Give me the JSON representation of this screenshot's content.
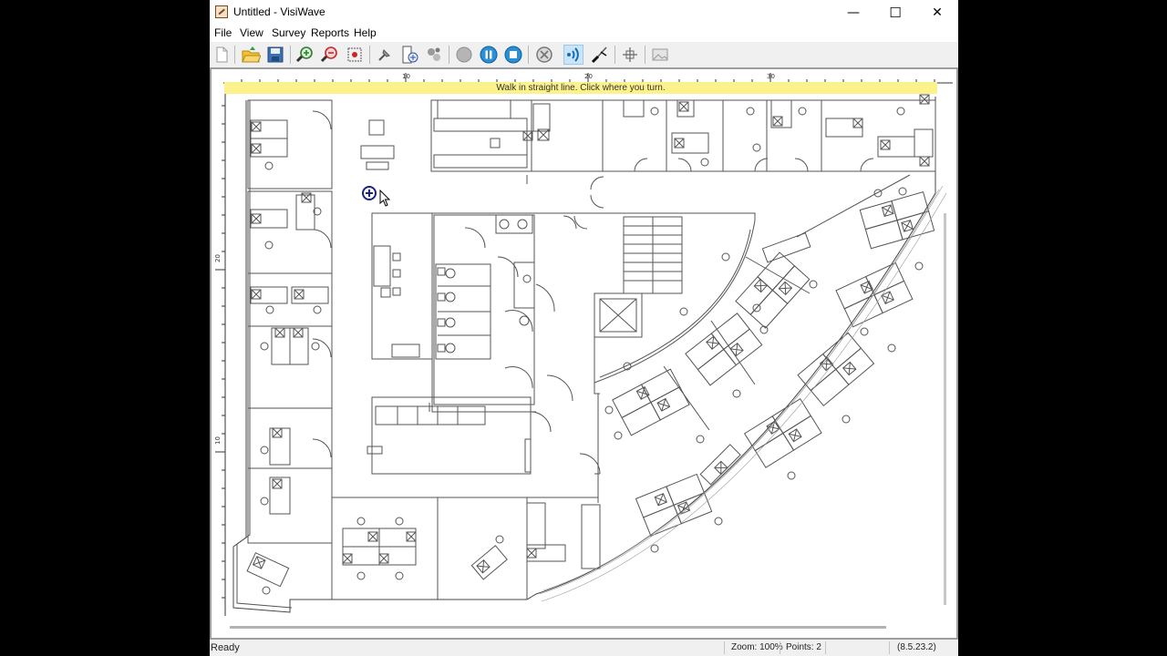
{
  "window": {
    "title": "Untitled - VisiWave",
    "controls": {
      "minimize": "—",
      "maximize": "☐",
      "close": "✕"
    }
  },
  "menu": [
    "File",
    "View",
    "Survey",
    "Reports",
    "Help"
  ],
  "toolbar": {
    "buttons": [
      {
        "name": "new-document-icon"
      },
      {
        "name": "open-folder-icon"
      },
      {
        "name": "save-icon"
      },
      {
        "name": "zoom-in-icon"
      },
      {
        "name": "zoom-out-icon"
      },
      {
        "name": "zoom-fit-icon"
      },
      {
        "name": "pin-icon"
      },
      {
        "name": "add-point-icon"
      },
      {
        "name": "survey-settings-icon"
      },
      {
        "name": "record-icon"
      },
      {
        "name": "pause-icon"
      },
      {
        "name": "stop-icon"
      },
      {
        "name": "cancel-icon"
      },
      {
        "name": "wifi-signal-icon"
      },
      {
        "name": "continuous-walk-icon"
      },
      {
        "name": "move-points-icon"
      },
      {
        "name": "image-icon"
      }
    ],
    "colors": {
      "accent": "#0d6eb8",
      "active_bg": "#cce4f7"
    }
  },
  "ruler": {
    "h_labels": [
      "10",
      "20",
      "30"
    ],
    "v_labels": [
      "20",
      "10"
    ]
  },
  "hint": "Walk in straight line. Click where you turn.",
  "status": {
    "left": "Ready",
    "zoom": "Zoom: 100%",
    "points": "Points: 2",
    "version": "(8.5.23.2)"
  }
}
